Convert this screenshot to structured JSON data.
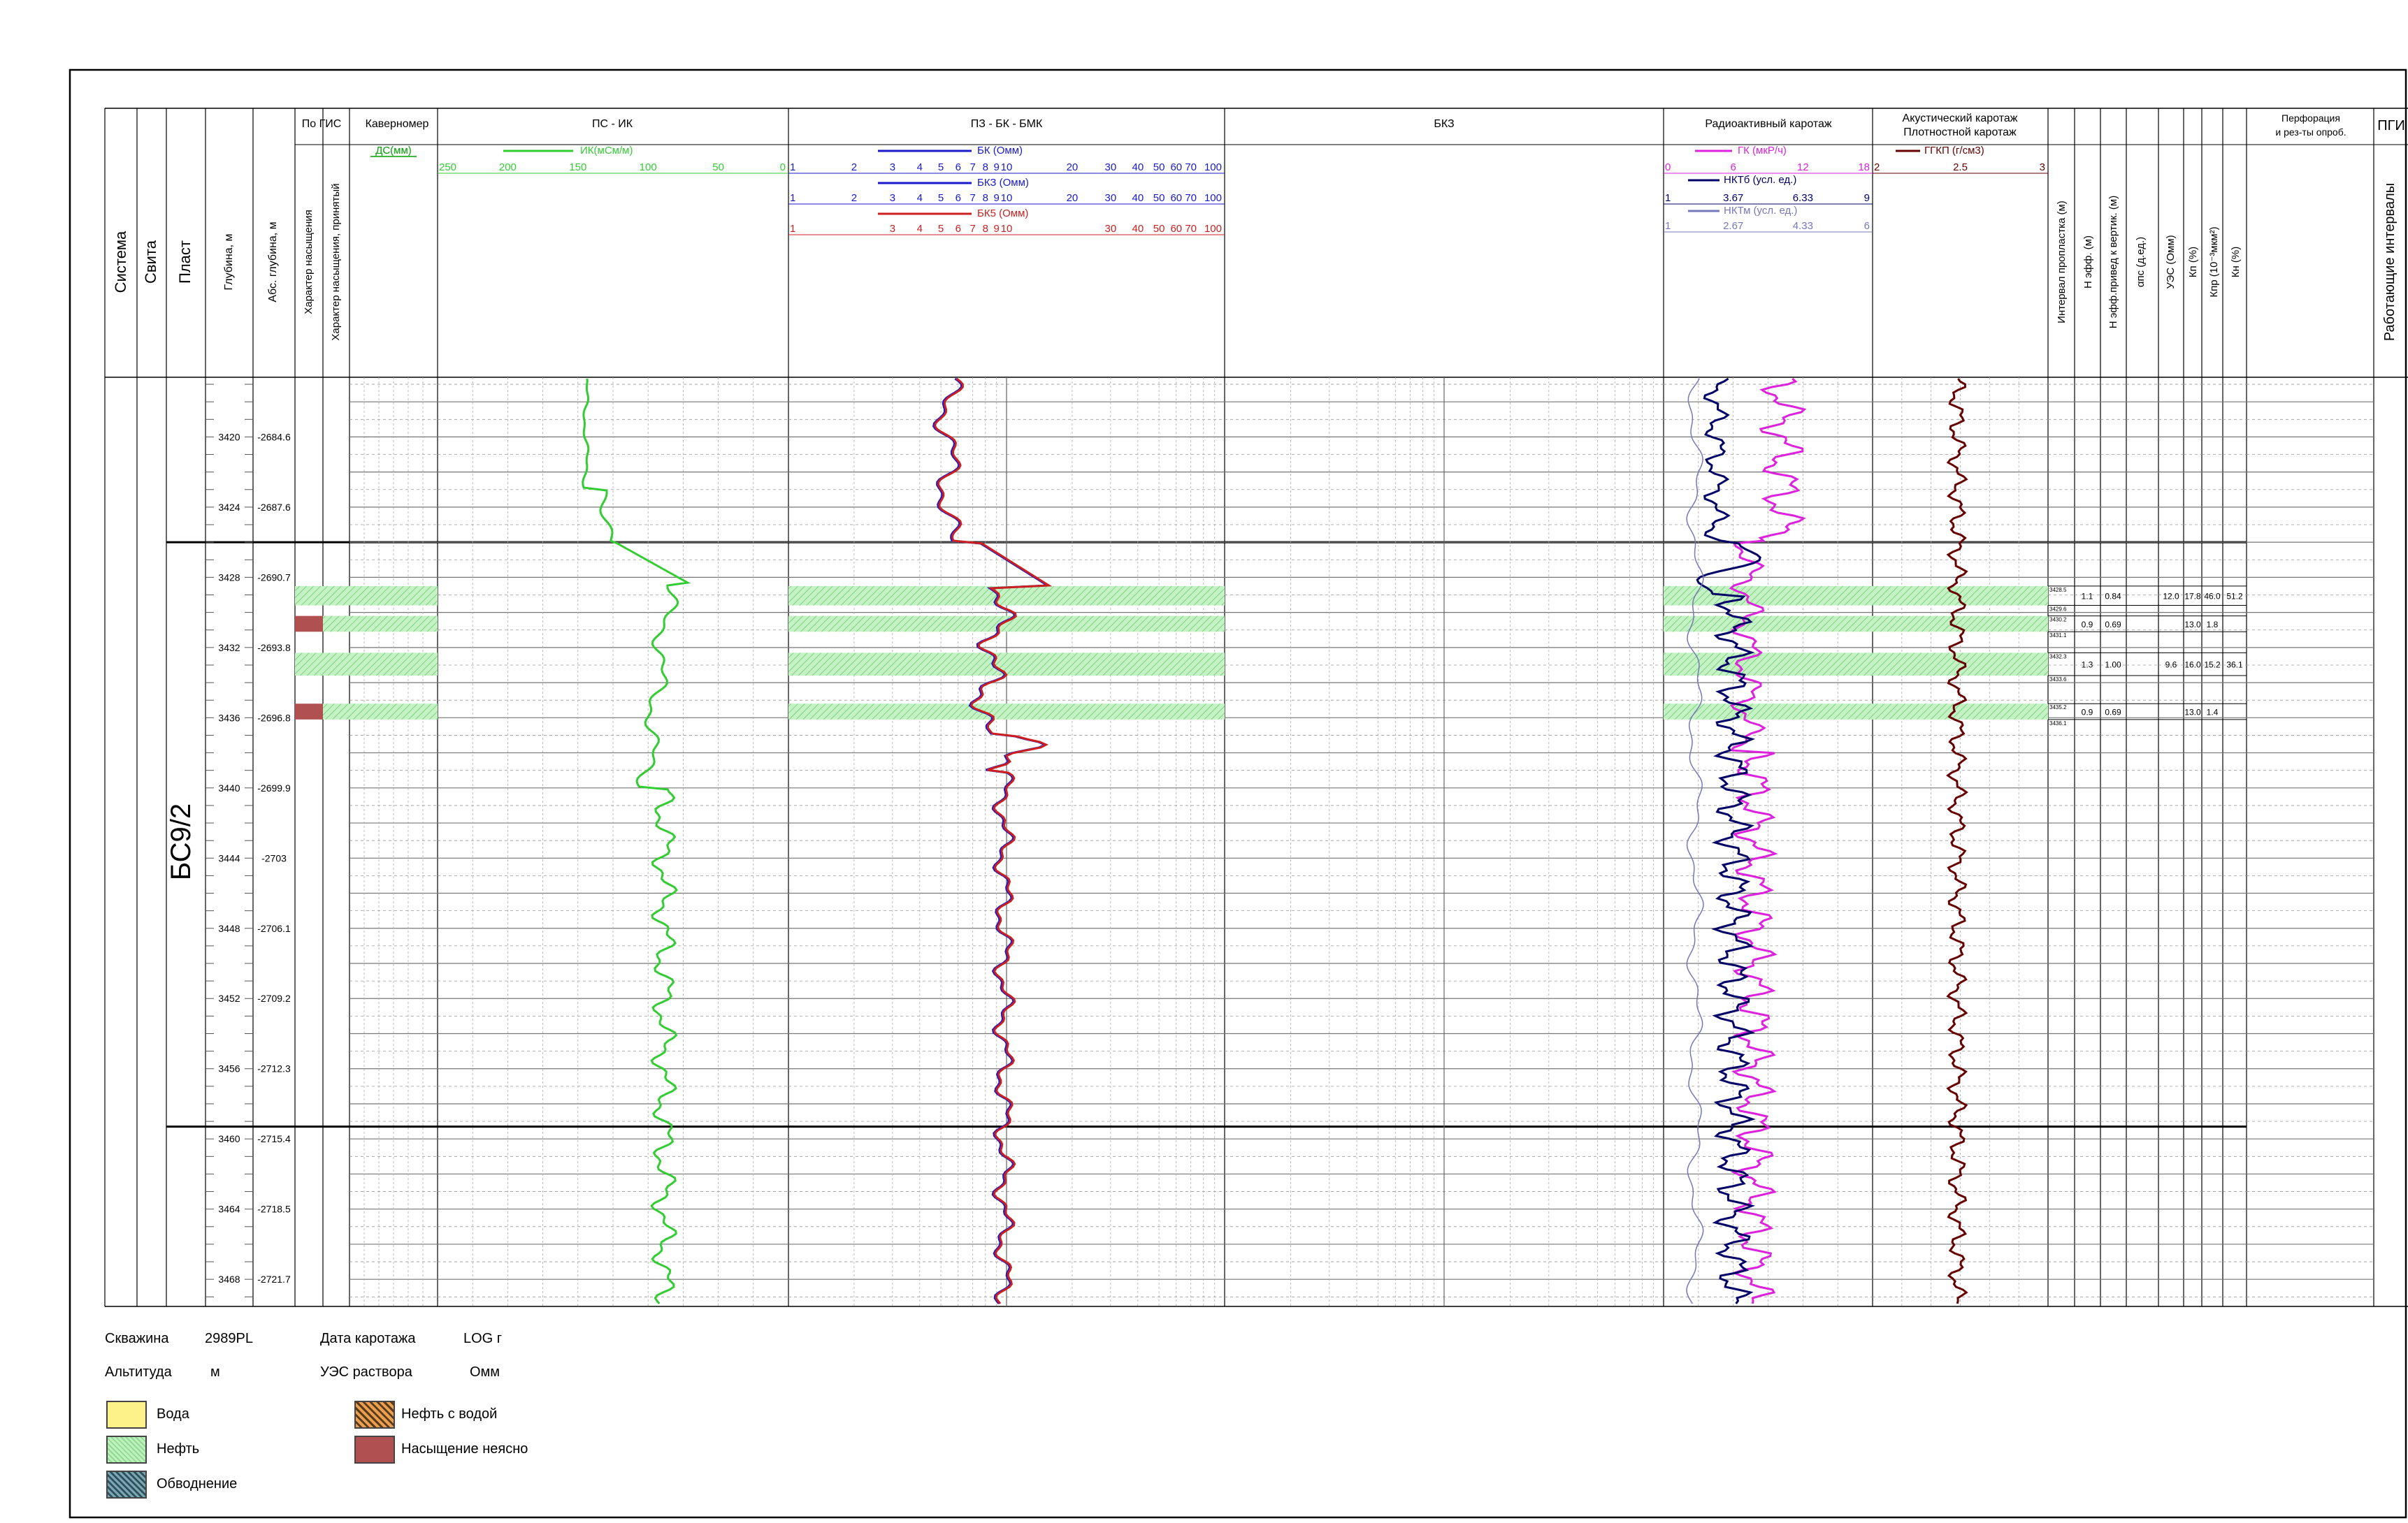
{
  "tracks": {
    "po_gis": "По ГИС",
    "kavernomer": "Каверномер",
    "ps_ik": "ПС - ИК",
    "pz_bk_bmk": "ПЗ - БК - БМК",
    "bkz": "БКЗ",
    "radio": "Радиоактивный каротаж",
    "acoustic_1": "Акустический каротаж",
    "acoustic_2": "Плотностной каротаж",
    "perf_1": "Перфорация",
    "perf_2": "и рез-ты опроб.",
    "pgi": "ПГИ"
  },
  "vertical_headers": {
    "sistema": "Система",
    "svita": "Свита",
    "plast": "Пласт",
    "depth": "Глубина, м",
    "abs_depth": "Абс. глубина, м",
    "sat_char": "Характер насыщения",
    "sat_char_accepted": "Характер насыщения, принятый",
    "interval": "Интервал пропластка (м)",
    "h_eff": "Н эфф. (м)",
    "h_eff_vert": "Н эфф.привед к вертик. (м)",
    "alpha": "αпс (д.ед.)",
    "uez": "УЭС (Омм)",
    "kp": "Кп (%)",
    "kpr": "Кпр (10⁻³мкм²)",
    "kn": "Кн (%)",
    "working": "Работающие интервалы"
  },
  "curves": {
    "ds": {
      "label": "ДС(мм)",
      "color": "#00a000"
    },
    "ik": {
      "label": "ИК(мСм/м)",
      "color": "#33cc33",
      "ticks": [
        "250",
        "200",
        "150",
        "100",
        "50",
        "0"
      ]
    },
    "bk": {
      "label": "БК (Омм)",
      "color": "#1a1acc",
      "ticks": [
        "1",
        "2",
        "3",
        "4",
        "5",
        "6",
        "7",
        "8",
        "9",
        "10",
        "20",
        "30",
        "40",
        "50",
        "60",
        "70",
        "100"
      ]
    },
    "bkz": {
      "label": "БКЗ (Омм)",
      "color": "#1a1acc",
      "ticks": [
        "1",
        "2",
        "3",
        "4",
        "5",
        "6",
        "7",
        "8",
        "9",
        "10",
        "20",
        "30",
        "40",
        "50",
        "60",
        "70",
        "100"
      ]
    },
    "bk5": {
      "label": "БК5 (Омм)",
      "color": "#cc2020",
      "ticks": [
        "1",
        "3",
        "4",
        "5",
        "6",
        "7",
        "8",
        "9",
        "10",
        "30",
        "40",
        "50",
        "60",
        "70",
        "100"
      ]
    },
    "gk": {
      "label": "ГК (мкР/ч)",
      "color": "#dd22dd",
      "ticks": [
        "0",
        "6",
        "12",
        "18"
      ]
    },
    "nkt6": {
      "label": "НКТб (усл. ед.)",
      "color": "#000066",
      "ticks": [
        "1",
        "3.67",
        "6.33",
        "9"
      ]
    },
    "nktm": {
      "label": "НКТм (усл. ед.)",
      "color": "#7777bb",
      "ticks": [
        "1",
        "2.67",
        "4.33",
        "6"
      ]
    },
    "ggkp": {
      "label": "ГГКП (г/см3)",
      "color": "#660000",
      "ticks": [
        "2",
        "2.5",
        "3"
      ]
    }
  },
  "formation": "БС9/2",
  "depths": [
    {
      "md": "3420",
      "abs": "-2684.6"
    },
    {
      "md": "3424",
      "abs": "-2687.6"
    },
    {
      "md": "3428",
      "abs": "-2690.7"
    },
    {
      "md": "3432",
      "abs": "-2693.8"
    },
    {
      "md": "3436",
      "abs": "-2696.8"
    },
    {
      "md": "3440",
      "abs": "-2699.9"
    },
    {
      "md": "3444",
      "abs": "-2703"
    },
    {
      "md": "3448",
      "abs": "-2706.1"
    },
    {
      "md": "3452",
      "abs": "-2709.2"
    },
    {
      "md": "3456",
      "abs": "-2712.3"
    },
    {
      "md": "3460",
      "abs": "-2715.4"
    },
    {
      "md": "3464",
      "abs": "-2718.5"
    },
    {
      "md": "3468",
      "abs": "-2721.7"
    }
  ],
  "layers": [
    {
      "top": 3428.5,
      "bottom": 3429.6,
      "sat": "oil",
      "top_label": "3428.5",
      "bottom_label": "3429.6",
      "h_eff": "1.1",
      "h_vert": "0.84",
      "alpha": "",
      "uez": "12.0",
      "kp": "17.8",
      "kpr": "46.0",
      "kn": "51.2"
    },
    {
      "top": 3430.2,
      "bottom": 3431.1,
      "sat": "unclear",
      "top_label": "3430.2",
      "bottom_label": "3431.1",
      "h_eff": "0.9",
      "h_vert": "0.69",
      "alpha": "",
      "uez": "",
      "kp": "13.0",
      "kpr": "1.8",
      "kn": ""
    },
    {
      "top": 3432.3,
      "bottom": 3433.6,
      "sat": "oil",
      "top_label": "3432.3",
      "bottom_label": "3433.6",
      "h_eff": "1.3",
      "h_vert": "1.00",
      "alpha": "",
      "uez": "9.6",
      "kp": "16.0",
      "kpr": "15.2",
      "kn": "36.1"
    },
    {
      "top": 3435.2,
      "bottom": 3436.1,
      "sat": "unclear",
      "top_label": "3435.2",
      "bottom_label": "3436.1",
      "h_eff": "0.9",
      "h_vert": "0.69",
      "alpha": "",
      "uez": "",
      "kp": "13.0",
      "kpr": "1.4",
      "kn": ""
    }
  ],
  "info": {
    "well_label": "Скважина",
    "well_value": "2989PL",
    "date_label": "Дата каротажа",
    "date_value": "LOG г",
    "altitude_label": "Альтитуда",
    "altitude_unit": "м",
    "mud_label": "УЭС раствора",
    "mud_unit": "Омм"
  },
  "legend": {
    "water": "Вода",
    "oil": "Нефть",
    "flooding": "Обводнение",
    "oil_water": "Нефть с водой",
    "unclear": "Насыщение неясно"
  },
  "colors": {
    "oil_fill": "#b8efb8",
    "unclear_fill": "#b05050",
    "water_fill": "#fdf28a"
  }
}
